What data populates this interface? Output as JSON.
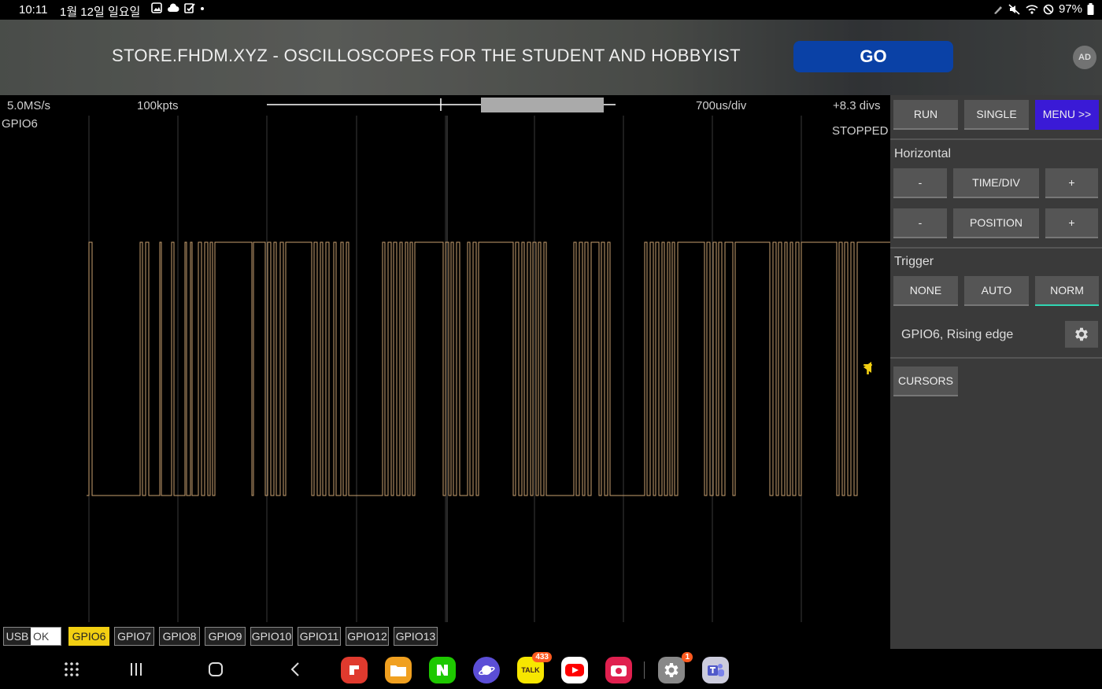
{
  "status_bar": {
    "time": "10:11",
    "date": "1월 12일 일요일",
    "battery": "97%"
  },
  "ad": {
    "text": "STORE.FHDM.XYZ - OSCILLOSCOPES FOR THE STUDENT AND HOBBYIST",
    "go_label": "GO",
    "badge": "AD"
  },
  "scope": {
    "sample_rate": "5.0MS/s",
    "points": "100kpts",
    "time_div": "700us/div",
    "offset": "+8.3 divs",
    "channel": "GPIO6",
    "state": "STOPPED",
    "trigger_marker": "T",
    "trace_color": "#c8a070"
  },
  "channels": {
    "usb_label": "USB",
    "usb_status": "OK",
    "items": [
      "GPIO6",
      "GPIO7",
      "GPIO8",
      "GPIO9",
      "GPIO10",
      "GPIO11",
      "GPIO12",
      "GPIO13"
    ],
    "active": "GPIO6"
  },
  "panel": {
    "run": "RUN",
    "single": "SINGLE",
    "menu": "MENU >>",
    "horizontal_title": "Horizontal",
    "minus": "-",
    "plus": "+",
    "time_div": "TIME/DIV",
    "position": "POSITION",
    "trigger_title": "Trigger",
    "none": "NONE",
    "auto": "AUTO",
    "norm": "NORM",
    "trigger_desc": "GPIO6, Rising edge",
    "cursors": "CURSORS"
  },
  "nav": {
    "talk_badge": "433",
    "talk_label": "TALK",
    "settings_badge": "1"
  }
}
